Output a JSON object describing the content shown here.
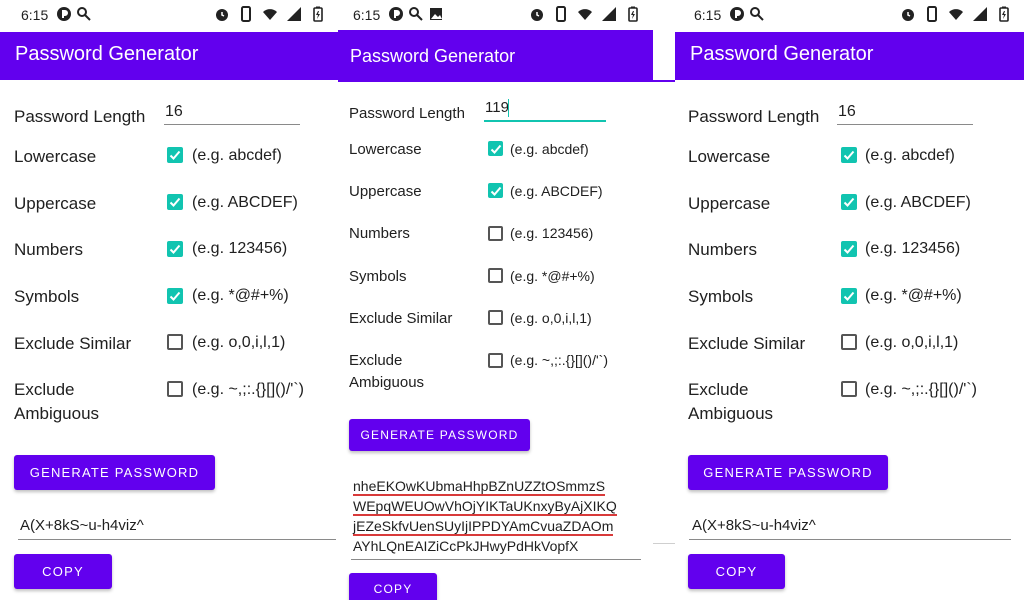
{
  "status_bar": {
    "time": "6:15"
  },
  "app": {
    "title": "Password Generator"
  },
  "colors": {
    "primary": "#6200ee",
    "checkbox": "#11c4b0"
  },
  "form": {
    "length_label": "Password Length",
    "lowercase_label": "Lowercase",
    "uppercase_label": "Uppercase",
    "numbers_label": "Numbers",
    "symbols_label": "Symbols",
    "exclude_similar_label": "Exclude Similar",
    "exclude_amb_line1": "Exclude",
    "exclude_amb_line2": "Ambiguous",
    "lowercase_hint": "(e.g. abcdef)",
    "uppercase_hint": "(e.g. ABCDEF)",
    "numbers_hint": "(e.g. 123456)",
    "symbols_hint": "(e.g. *@#+%)",
    "similar_hint": "(e.g. o,0,i,l,1)",
    "ambiguous_hint": "(e.g. ~,;:.{}[]()/'`)"
  },
  "buttons": {
    "generate": "GENERATE PASSWORD",
    "copy": "COPY"
  },
  "screens": [
    {
      "length_value": "16",
      "password": "A(X+8kS~u-h4viz^"
    },
    {
      "length_value": "119",
      "password_lines": [
        "nheEKOwKUbmaHhpBZnUZZtOSmmzS",
        "WEpqWEUOwVhOjYIKTaUKnxyByAjXIKQ",
        "jEZeSkfvUenSUyIjIPPDYAmCvuaZDAOm",
        "AYhLQnEAIZiCcPkJHwyPdHkVopfX"
      ]
    },
    {
      "length_value": "16",
      "password": "A(X+8kS~u-h4viz^"
    }
  ],
  "icons": {
    "status_left": [
      "app-notification-icon",
      "link-icon",
      "image-icon"
    ],
    "status_right": [
      "alarm-icon",
      "phone-icon",
      "wifi-icon",
      "signal-icon",
      "battery-icon"
    ],
    "checkbox_checked": "check-icon"
  }
}
